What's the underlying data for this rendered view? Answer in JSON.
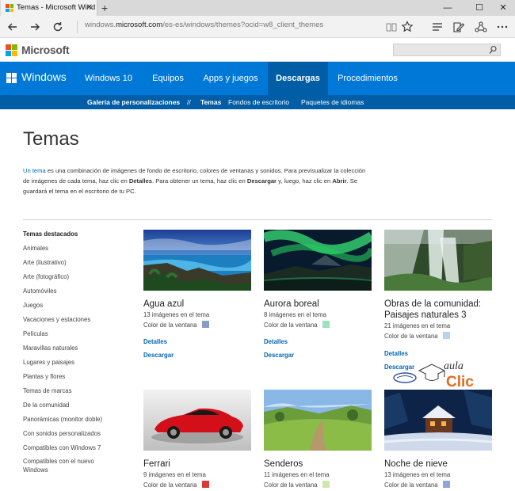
{
  "browser": {
    "tab_title": "Temas - Microsoft Wind",
    "tab_close": "✕",
    "new_tab": "+",
    "address_prefix": "windows.",
    "address_domain": "microsoft.com",
    "address_path": "/es-es/windows/themes?ocid=w8_client_themes",
    "window_controls": {
      "minimize": "—",
      "maximize": "☐",
      "close": "✕"
    }
  },
  "site": {
    "brand": "Microsoft",
    "product": "Windows"
  },
  "nav": {
    "items": [
      "Windows 10",
      "Equipos",
      "Apps y juegos",
      "Descargas",
      "Procedimientos"
    ],
    "active": "Descargas"
  },
  "subnav": {
    "items": [
      "Galería de personalizaciones",
      "//",
      "Temas",
      "Fondos de escritorio",
      "Paquetes de idiomas"
    ]
  },
  "page": {
    "title": "Temas",
    "intro": {
      "link": "Un tema",
      "t1": " es una combinación de imágenes de fondo de escritorio, colores de ventanas y sonidos. Para previsualizar la colección de imágenes de cada tema, haz clic en ",
      "b1": "Detalles",
      "t2": ". Para obtener un tema, haz clic en ",
      "b2": "Descargar",
      "t3": " y, luego, haz clic en ",
      "b3": "Abrir",
      "t4": ". Se guardará el tema en el escritorio de tu PC."
    }
  },
  "sidebar": {
    "items": [
      "Temas destacados",
      "Animales",
      "Arte (ilustrativo)",
      "Arte (fotográfico)",
      "Automóviles",
      "Juegos",
      "Vacaciones y estaciones",
      "Películas",
      "Maravillas naturales",
      "Lugares y paisajes",
      "Plantas y flores",
      "Temas de marcas",
      "De la comunidad",
      "Panorámicas (monitor doble)",
      "Con sonidos personalizados",
      "Compatibles con Windows 7",
      "Compatibles con el nuevo",
      "Windows"
    ]
  },
  "themes": [
    {
      "title": "Agua azul",
      "count": "13 imágenes en el tema",
      "color_label": "Color de la ventana",
      "color": "#8a9cc4",
      "details": "Detalles",
      "download": "Descargar"
    },
    {
      "title": "Aurora boreal",
      "count": "8 imágenes en el tema",
      "color_label": "Color de la ventana",
      "color": "#9be0bf",
      "details": "Detalles",
      "download": "Descargar"
    },
    {
      "title": "Obras de la comunidad:",
      "title2": "Paisajes naturales 3",
      "count": "21 imágenes en el tema",
      "color_label": "Color de la ventana",
      "color": "#b9d3ee",
      "details": "Detalles",
      "download": "Descargar"
    },
    {
      "title": "Ferrari",
      "count": "9 imágenes en el tema",
      "color_label": "Color de la ventana",
      "color": "#d93a3a"
    },
    {
      "title": "Senderos",
      "count": "11 imágenes en el tema",
      "color_label": "Color de la ventana",
      "color": "#cfe6b0"
    },
    {
      "title": "Noche de nieve",
      "count": "13 imágenes en el tema",
      "color_label": "Color de la ventana",
      "color": "#8ea6d8"
    }
  ],
  "watermark": {
    "line1": "aula",
    "line2": "Clic"
  }
}
